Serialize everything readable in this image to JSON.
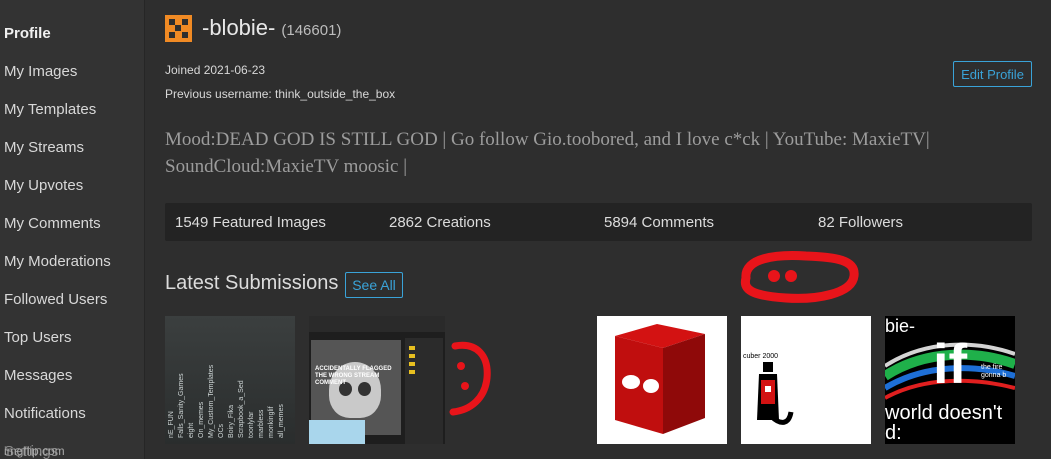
{
  "sidebar": {
    "items": [
      {
        "label": "Profile",
        "active": true
      },
      {
        "label": "My Images"
      },
      {
        "label": "My Templates"
      },
      {
        "label": "My Streams"
      },
      {
        "label": "My Upvotes"
      },
      {
        "label": "My Comments"
      },
      {
        "label": "My Moderations"
      },
      {
        "label": "Followed Users"
      },
      {
        "label": "Top Users"
      },
      {
        "label": "Messages"
      },
      {
        "label": "Notifications"
      }
    ],
    "watermark": "imgflip.com",
    "partial_item": "Settings"
  },
  "profile": {
    "username": "-blobie-",
    "user_id": "(146601)",
    "joined": "Joined 2021-06-23",
    "previous_username": "Previous username: think_outside_the_box",
    "edit_button": "Edit Profile",
    "mood": "Mood:DEAD GOD IS STILL GOD | Go follow Gio.toobored, and I love c*ck | YouTube: MaxieTV| SoundCloud:MaxieTV moosic |"
  },
  "stats": {
    "featured": "1549 Featured Images",
    "creations": "2862 Creations",
    "comments": "5894 Comments",
    "followers": "82 Followers"
  },
  "latest": {
    "title": "Latest Submissions",
    "see_all": "See All"
  },
  "thumbnails": {
    "t1_lines": [
      "nE_FUN",
      "Falls_Sanity_Games",
      "eight",
      "On_memes",
      "My_Custom_Templates",
      "OCs",
      "Boiry_Fika",
      "Scrapbook_a_Sed",
      "toonlylar",
      "marbless",
      "monkinglif",
      "all_memes"
    ],
    "t2_caption_line1": "ACCIDENTALLY FLAGGED",
    "t2_caption_line2": "THE WRONG STREAM COMMENT",
    "t5_label": "cuber 2000",
    "t6_line1": "bie-",
    "t6_big": "if",
    "t6_line2": "world doesn't",
    "t6_line3": "d:",
    "t6_small": "the fire gonna b"
  },
  "colors": {
    "accent": "#3aa3d8",
    "avatar": "#f08a24",
    "scribble_red": "#e8141a"
  }
}
